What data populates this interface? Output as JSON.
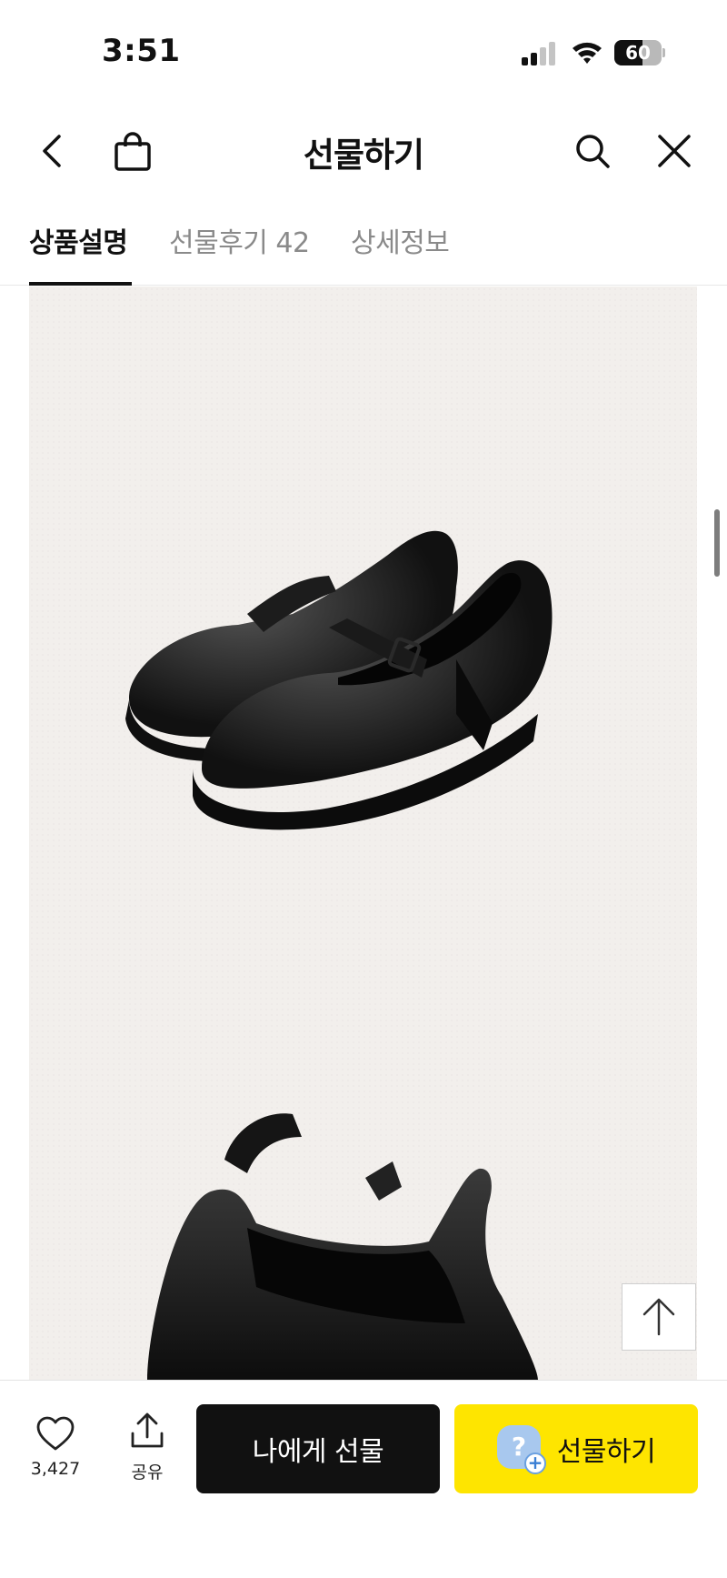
{
  "status_bar": {
    "time": "3:51",
    "battery_level": 60,
    "battery_text": "60",
    "icons": [
      "signal-icon",
      "wifi-icon",
      "battery-icon"
    ]
  },
  "header": {
    "title": "선물하기",
    "icons": [
      "back-icon",
      "shopping-bag-icon",
      "search-icon",
      "close-icon"
    ]
  },
  "tabs": [
    {
      "label": "상품설명",
      "active": true
    },
    {
      "label": "선물후기 42",
      "active": false
    },
    {
      "label": "상세정보",
      "active": false
    }
  ],
  "content": {
    "image_subject": "black mary-jane platform shoes",
    "image_background_color": "#f2efec",
    "scroll_top_icon": "arrow-up-icon"
  },
  "bottom_bar": {
    "like_icon": "heart-icon",
    "like_count": "3,427",
    "share_icon": "share-icon",
    "share_label": "공유",
    "gift_self_label": "나에게 선물",
    "gift_label": "선물하기",
    "gift_badge_text": "?",
    "colors": {
      "gift_self_bg": "#111111",
      "gift_bg": "#fee500"
    }
  }
}
